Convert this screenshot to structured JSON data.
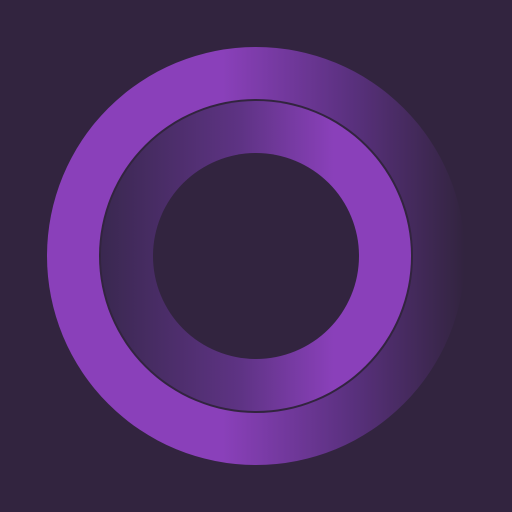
{
  "app_icon": {
    "icon_name": "double-ring-logo-icon",
    "colors": {
      "background": "#32243F",
      "ring_highlight": "#8A40BA",
      "ring_mid": "#6B3596",
      "ring_shadow": "#3F2A55"
    }
  }
}
